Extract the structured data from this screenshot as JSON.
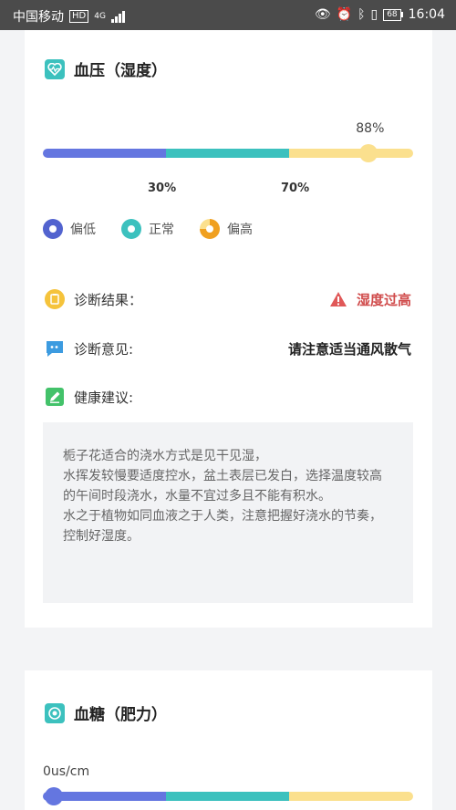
{
  "status_bar": {
    "carrier": "中国移动",
    "hd_badge": "HD",
    "network": "4G",
    "battery": "68",
    "time": "16:04"
  },
  "blood_pressure": {
    "title": "血压（湿度）",
    "current_label": "88%",
    "current_fraction": 0.88,
    "ticks": [
      "30%",
      "70%"
    ],
    "legend": [
      "偏低",
      "正常",
      "偏高"
    ],
    "colors": {
      "low": "#6476e0",
      "normal": "#3cc1be",
      "high": "#fbe08e",
      "alert": "#e05858"
    }
  },
  "diagnosis": {
    "result_label": "诊断结果：",
    "result_value": "湿度过高",
    "opinion_label": "诊断意见:",
    "opinion_value": "请注意适当通风散气",
    "advice_label": "健康建议:",
    "advice_lines": [
      "栀子花适合的浇水方式是见干见湿，",
      "水挥发较慢要适度控水，盆土表层已发白，选择温度较高的午间时段浇水，水量不宜过多且不能有积水。",
      "水之于植物如同血液之于人类，注意把握好浇水的节奏，控制好湿度。"
    ]
  },
  "blood_sugar": {
    "title": "血糖（肥力）",
    "current_label": "0us/cm",
    "current_fraction": 0.03
  }
}
